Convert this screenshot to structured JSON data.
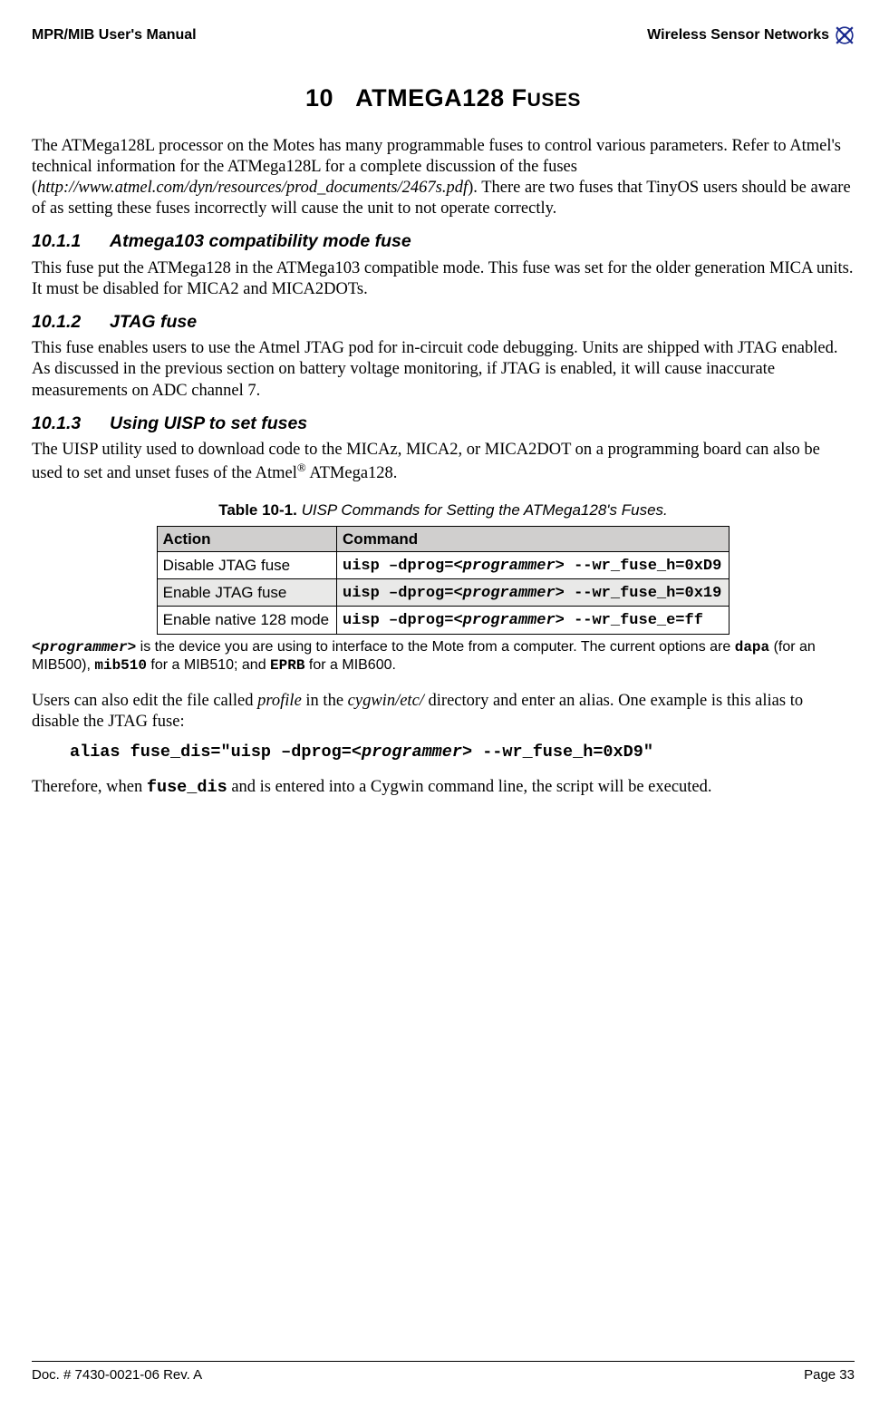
{
  "header": {
    "left": "MPR/MIB User's Manual",
    "right": "Wireless Sensor Networks"
  },
  "title_num": "10",
  "title_main": "ATMEGA128 F",
  "title_tail": "USES",
  "intro": "The ATMega128L processor on the Motes has many programmable fuses to control various parameters. Refer to Atmel's technical information for the ATMega128L for a complete discussion of the fuses (",
  "intro_link": "http://www.atmel.com/dyn/resources/prod_documents/2467s.pdf",
  "intro_tail": "). There are two fuses that TinyOS users should be aware of as setting these fuses incorrectly will cause the unit to not operate correctly.",
  "sec1": {
    "num": "10.1.1",
    "title": "Atmega103 compatibility mode fuse",
    "body": "This fuse put the ATMega128 in the ATMega103 compatible mode. This fuse was set for the older generation MICA units. It must be disabled for MICA2 and MICA2DOTs."
  },
  "sec2": {
    "num": "10.1.2",
    "title": "JTAG fuse",
    "body": "This fuse enables users to use the Atmel JTAG pod for in-circuit code debugging. Units are shipped with JTAG enabled. As discussed in the previous section on battery voltage monitoring, if JTAG is enabled, it will cause inaccurate measurements on ADC channel 7."
  },
  "sec3": {
    "num": "10.1.3",
    "title": "Using UISP to set fuses",
    "body_a": "The UISP utility used to download code to the MICAz, MICA2, or MICA2DOT on a programming board can also be used to set and unset fuses of the Atmel",
    "body_b": " ATMega128."
  },
  "table_caption_bold": "Table 10-1.",
  "table_caption_rest": " UISP Commands for Setting the ATMega128's Fuses.",
  "table": {
    "h1": "Action",
    "h2": "Command",
    "rows": [
      {
        "a": "Disable JTAG fuse",
        "pre": "uisp –dprog=",
        "mid": "<programmer>",
        "post": " --wr_fuse_h=0xD9"
      },
      {
        "a": "Enable JTAG fuse",
        "pre": "uisp –dprog=",
        "mid": "<programmer>",
        "post": " --wr_fuse_h=0x19"
      },
      {
        "a": "Enable native 128 mode",
        "pre": "uisp –dprog=",
        "mid": "<programmer>",
        "post": " --wr_fuse_e=ff"
      }
    ]
  },
  "note_a": " is the device you are using to interface to the Mote from a computer. The current options are ",
  "note_b": " (for an MIB500), ",
  "note_c": " for a MIB510; and ",
  "note_d": " for a MIB600.",
  "note_prog": "<programmer>",
  "note_dapa": "dapa",
  "note_mib510": "mib510",
  "note_eprb": "EPRB",
  "alias_intro_a": "Users can also edit the file called ",
  "alias_intro_b": " in the ",
  "alias_intro_c": " directory and enter an alias. One example is this alias to disable the JTAG fuse:",
  "alias_profile": "profile",
  "alias_path": "cygwin/etc/",
  "alias_code_pre": "alias fuse_dis=\"uisp –dprog=",
  "alias_code_mid": "<programmer>",
  "alias_code_post": " --wr_fuse_h=0xD9\"",
  "closing_a": "Therefore, when ",
  "closing_cmd": "fuse_dis",
  "closing_b": " and is entered into a Cygwin command line, the script will be executed.",
  "footer": {
    "left": "Doc. # 7430-0021-06 Rev. A",
    "right": "Page 33"
  }
}
